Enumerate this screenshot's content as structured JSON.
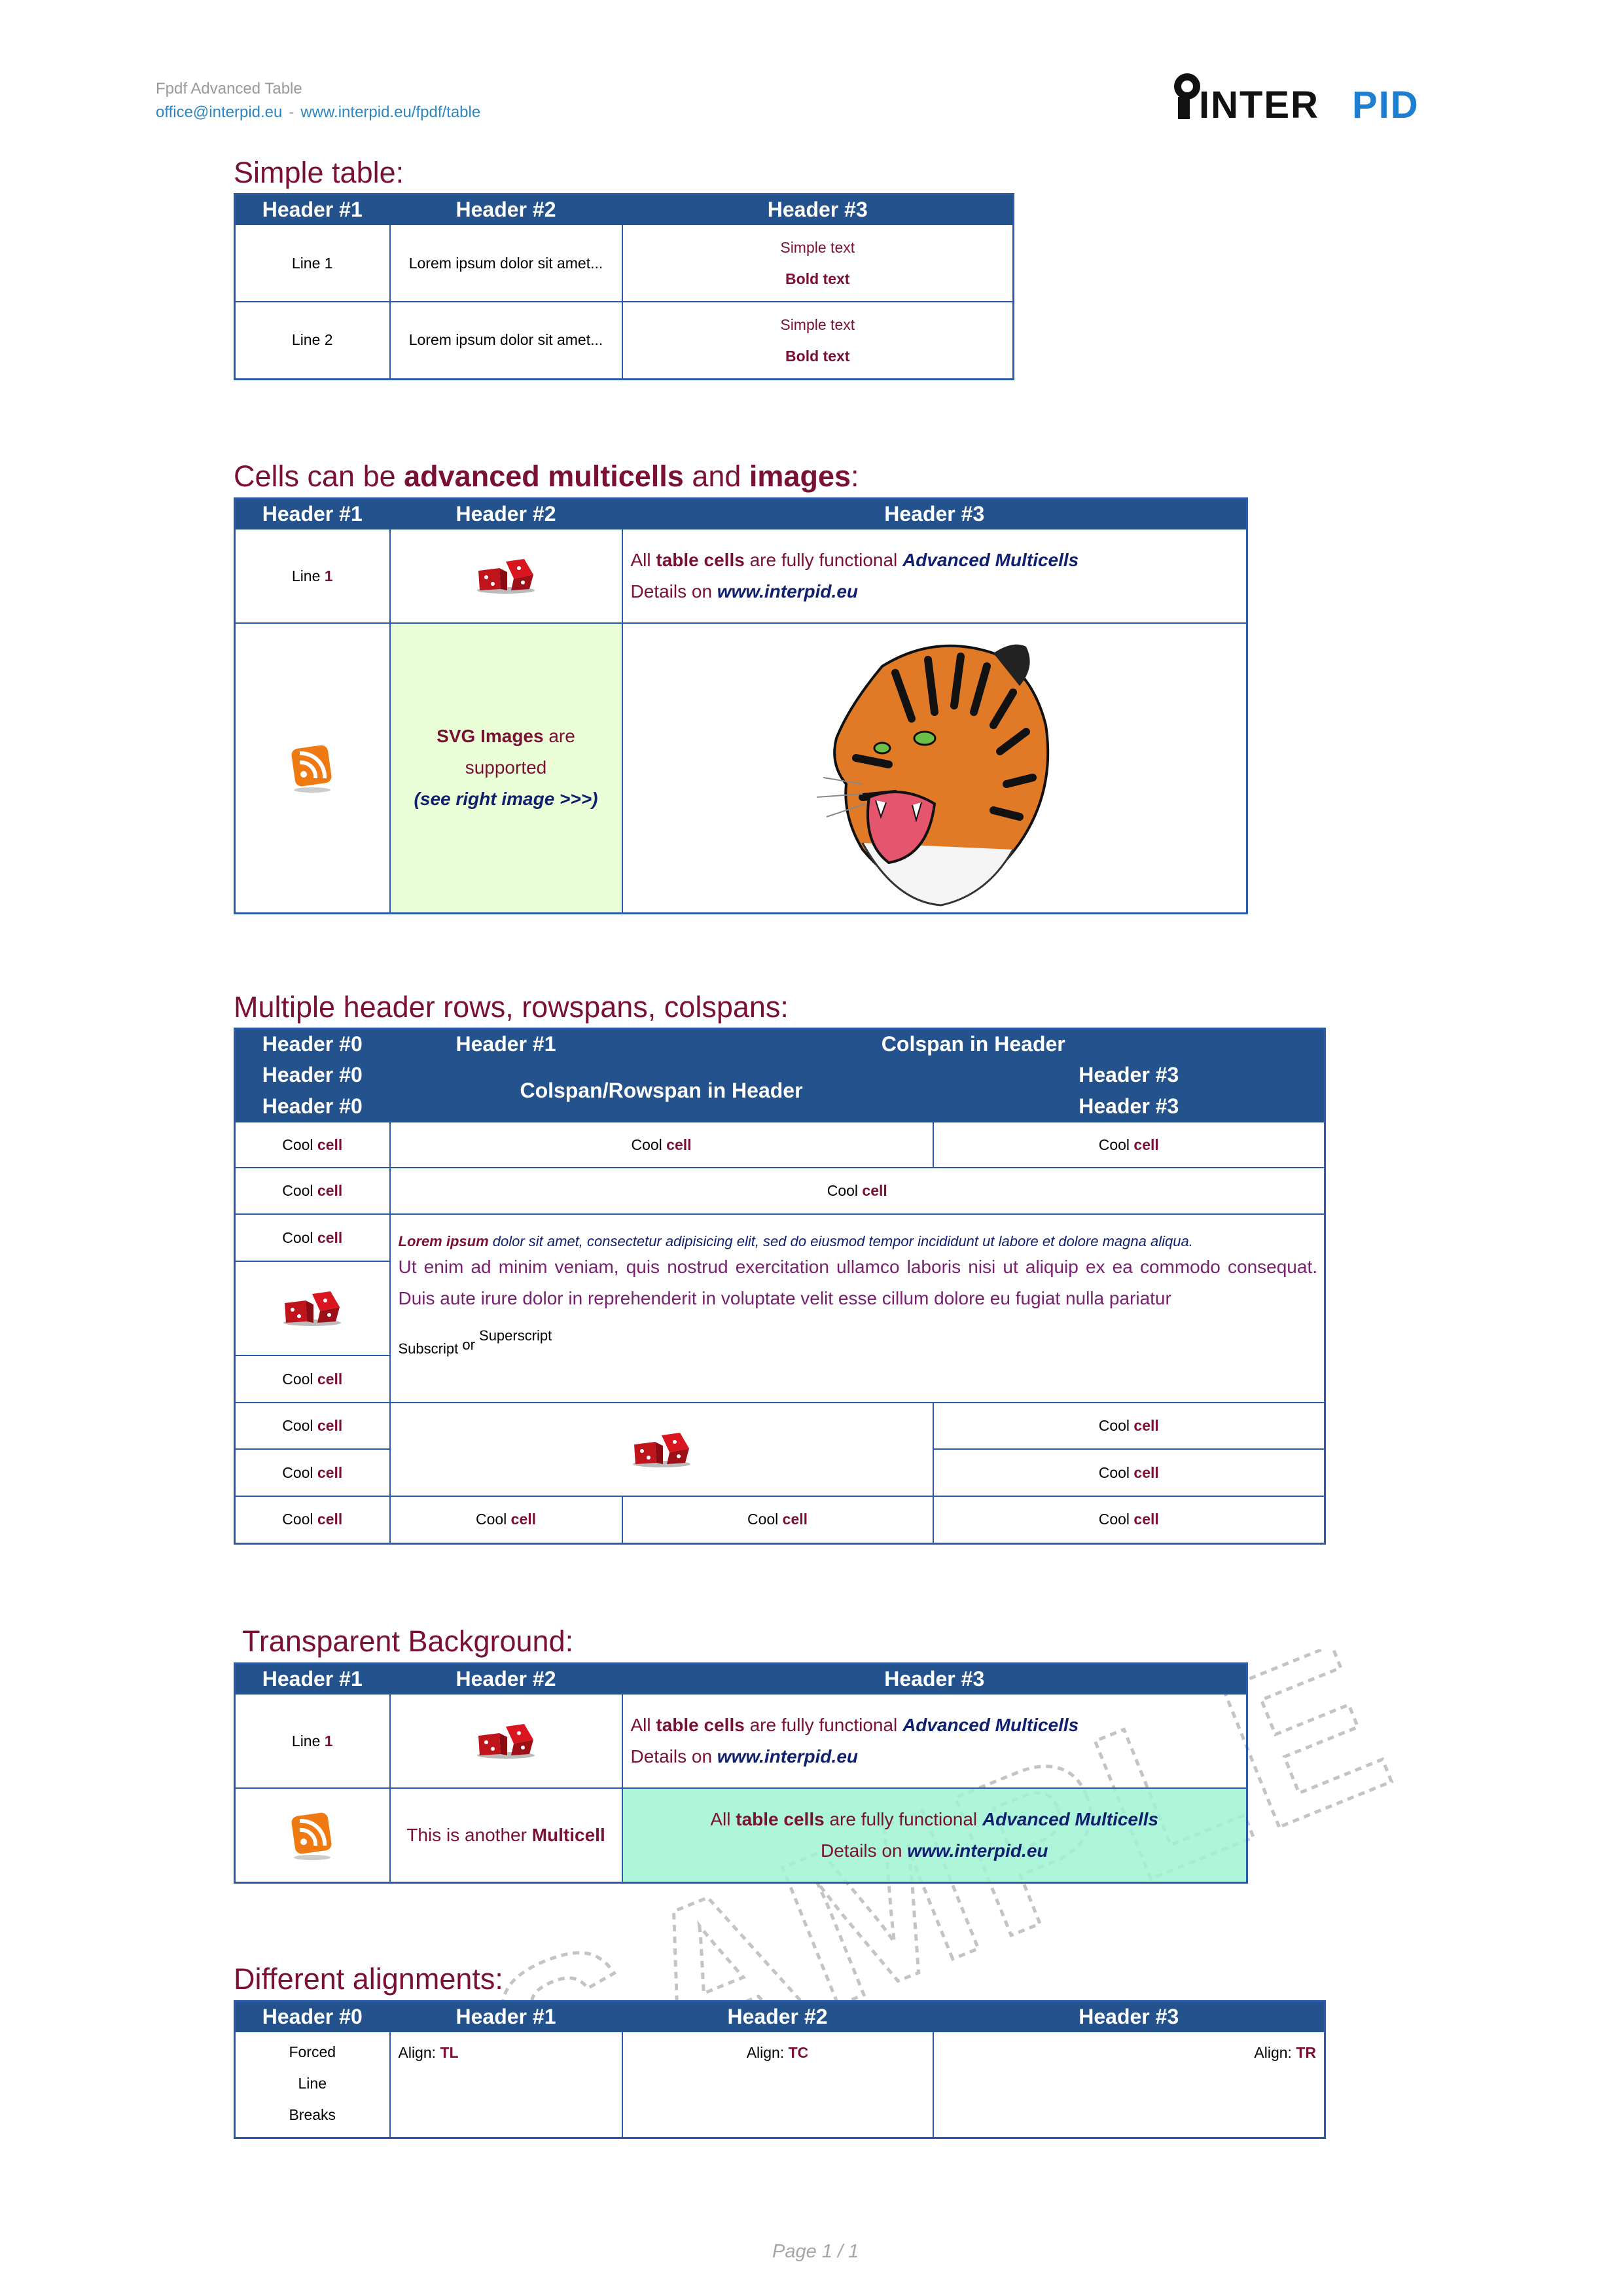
{
  "header": {
    "title": "Fpdf Advanced Table",
    "email": "office@interpid.eu",
    "separator": "-",
    "url": "www.interpid.eu/fpdf/table",
    "logo_text": "INTERPID"
  },
  "colors": {
    "header_bg": "#24528c",
    "border": "#2a5ba8",
    "accent": "#7a1034",
    "navy": "#10206e",
    "green_cell": "#eaffd8",
    "mint_cell": "#b4f7da"
  },
  "simple": {
    "title": "Simple table:",
    "headers": [
      "Header #1",
      "Header #2",
      "Header #3"
    ],
    "rows": [
      {
        "c1": "Line 1",
        "c2": "Lorem ipsum dolor sit amet...",
        "c3a": "Simple text",
        "c3b": "Bold text"
      },
      {
        "c1": "Line 2",
        "c2": "Lorem ipsum dolor sit amet...",
        "c3a": "Simple text",
        "c3b": "Bold text"
      }
    ]
  },
  "adv": {
    "title_pre": "Cells can be ",
    "title_b1": "advanced multicells",
    "title_mid": " and ",
    "title_b2": "images",
    "title_post": ":",
    "headers": [
      "Header #1",
      "Header #2",
      "Header #3"
    ],
    "line_label": "Line ",
    "line_num": "1",
    "mc_all": "All ",
    "mc_table_cells": "table cells",
    "mc_are": " are fully functional ",
    "mc_adv": "Advanced Multicells",
    "mc_details": "Details on ",
    "mc_url": "www.interpid.eu",
    "svg_b": "SVG Images",
    "svg_are": " are",
    "svg_supported": "supported",
    "svg_see": "(see right image >>>)",
    "icons": [
      "dice-icon",
      "rss-icon",
      "tiger-image"
    ]
  },
  "multi": {
    "title": "Multiple header rows, rowspans, colspans:",
    "h_row1": [
      "Header #0",
      "Header #1",
      "Colspan in Header"
    ],
    "h_row2_a": "Header #0",
    "h_row2_span": "Colspan/Rowspan in Header",
    "h_row2_c": "Header #3",
    "h_row3_a": "Header #0",
    "h_row3_c": "Header #3",
    "cool": "Cool ",
    "cell": "cell",
    "lorem_b": "Lorem ipsum",
    "lorem_i": " dolor sit amet, consectetur adipisicing elit, sed do eiusmod tempor incididunt ut labore et dolore magna aliqua.",
    "lorem_2": "Ut enim ad minim veniam, quis nostrud exercitation ullamco laboris nisi ut aliquip ex ea commodo consequat. Duis aute irure dolor in reprehenderit in voluptate velit esse cillum dolore eu fugiat nulla pariatur",
    "subscript": "Subscript",
    "or": " or ",
    "superscript": "Superscript"
  },
  "transp": {
    "title": "Transparent Background:",
    "headers": [
      "Header #1",
      "Header #2",
      "Header #3"
    ],
    "line_label": "Line ",
    "line_num": "1",
    "another": "This is another ",
    "another_b": "Multicell"
  },
  "align": {
    "title": "Different alignments:",
    "headers": [
      "Header #0",
      "Header #1",
      "Header #2",
      "Header #3"
    ],
    "forced": [
      "Forced",
      "Line",
      "Breaks"
    ],
    "align_label": "Align: ",
    "tl": "TL",
    "tc": "TC",
    "tr": "TR"
  },
  "watermark": "SAMPLE PDF",
  "footer": "Page 1 / 1"
}
